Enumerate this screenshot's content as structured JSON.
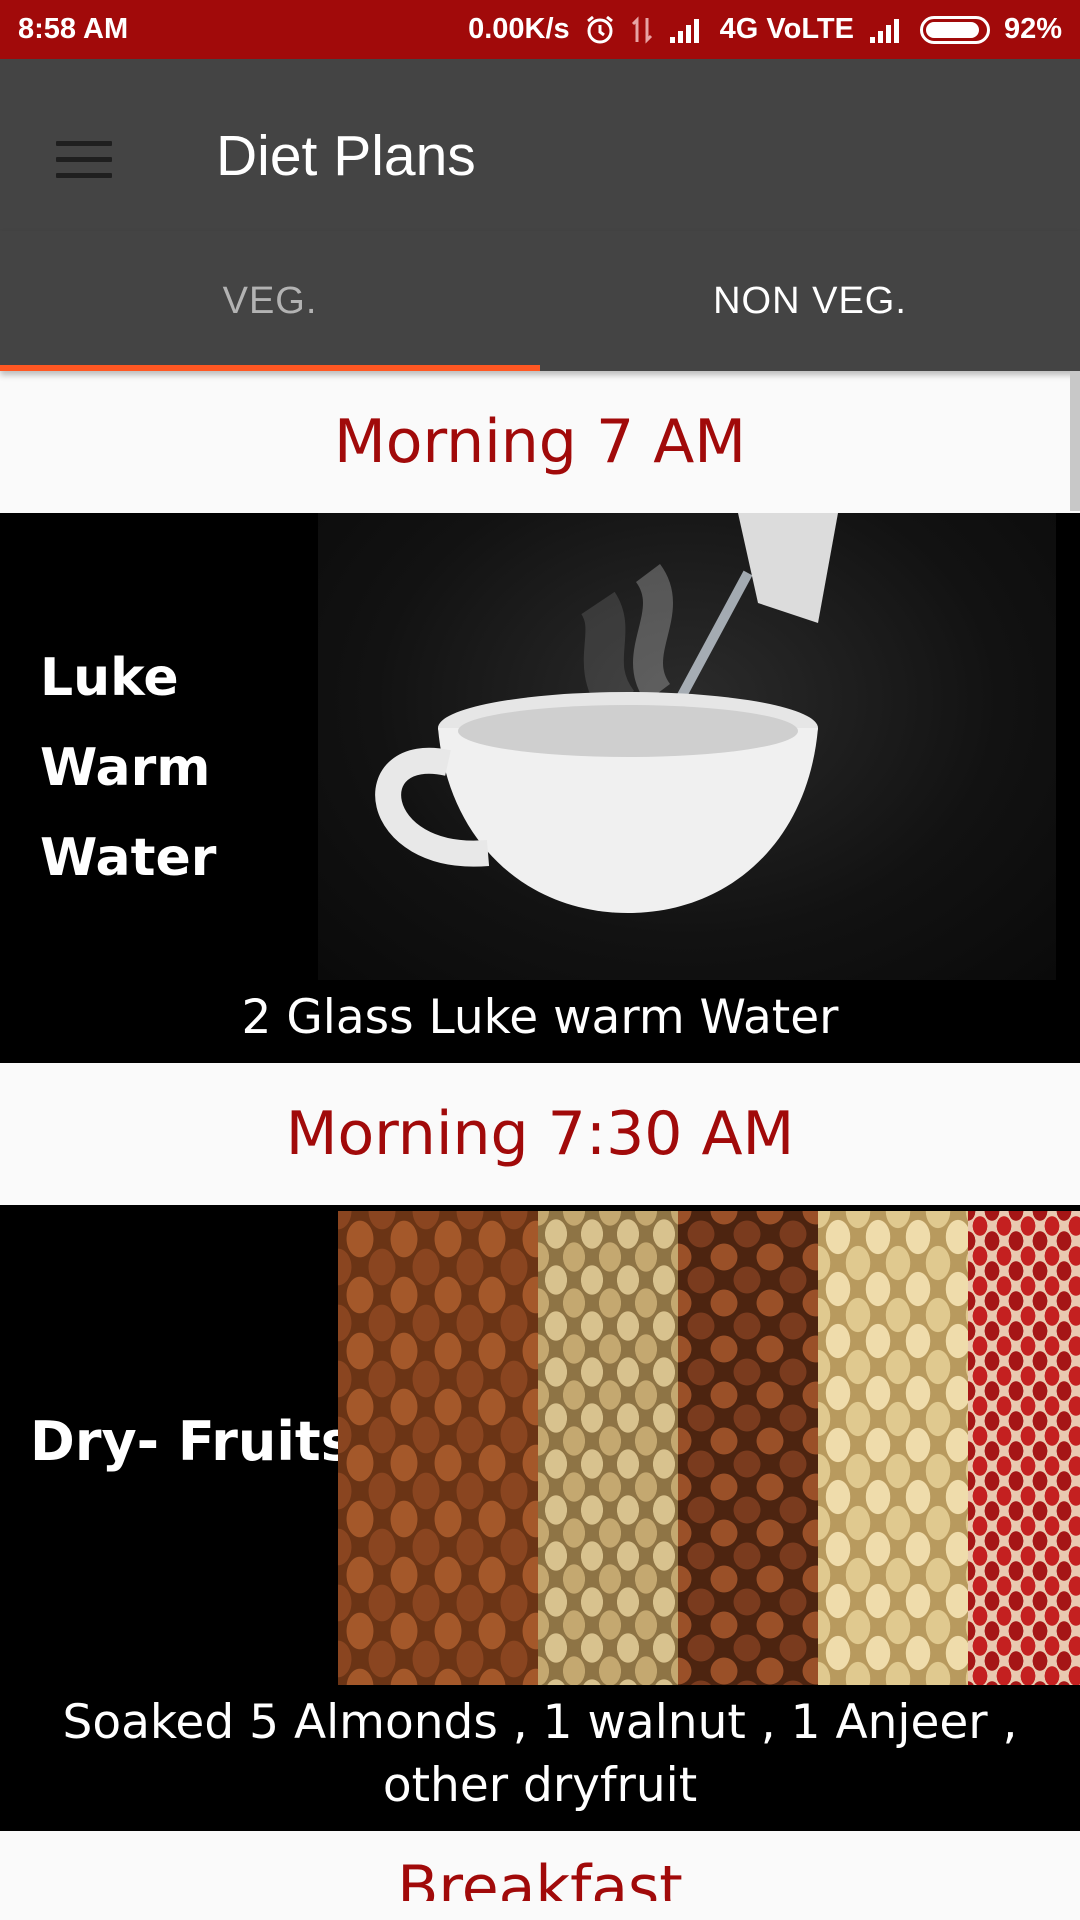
{
  "status_bar": {
    "time": "8:58 AM",
    "network_speed": "0.00K/s",
    "network_type": "4G VoLTE",
    "battery": "92%",
    "battery_level": 0.92
  },
  "toolbar": {
    "menu_icon": "hamburger-menu-icon",
    "title": "Diet Plans"
  },
  "tabs": [
    {
      "label": "VEG.",
      "selected": true
    },
    {
      "label": "NON VEG.",
      "selected": false
    }
  ],
  "colors": {
    "status_bar": "#a10a0a",
    "toolbar": "#444444",
    "tab_indicator": "#ff5722",
    "time_header_text": "#a10a0a"
  },
  "meals": [
    {
      "time": "Morning 7 AM",
      "image_label_lines": [
        "Luke",
        "Warm",
        "Water"
      ],
      "caption": "2 Glass Luke warm Water"
    },
    {
      "time": "Morning 7:30 AM",
      "image_label": "Dry- Fruits",
      "caption": "Soaked 5 Almonds , 1 walnut , 1 Anjeer , other dryfruit"
    },
    {
      "time": "Breakfast"
    }
  ]
}
